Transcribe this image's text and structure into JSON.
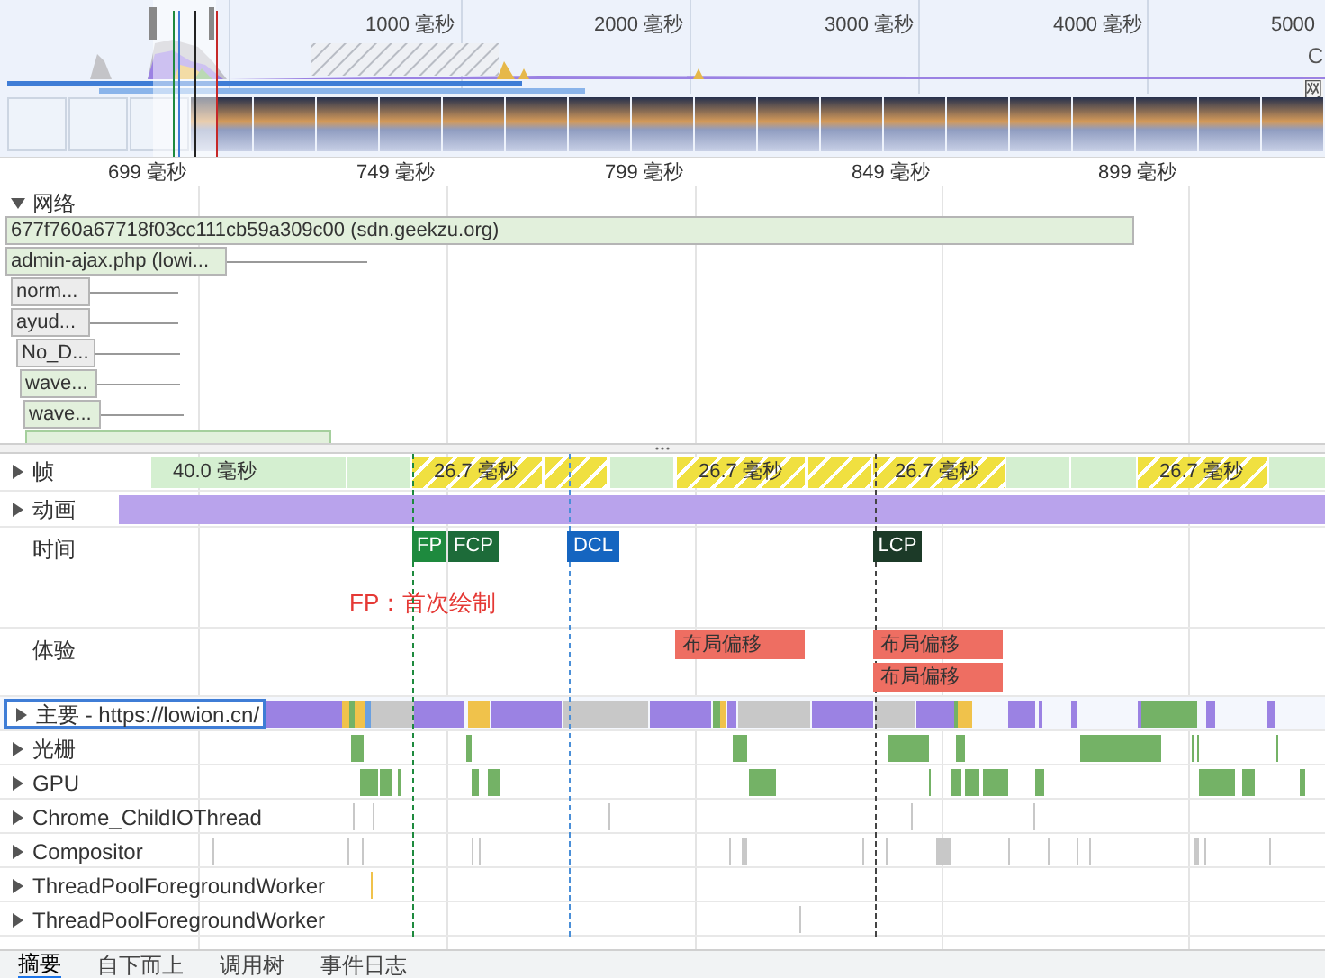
{
  "overview": {
    "ticks": [
      "1000 毫秒",
      "2000 毫秒",
      "3000 毫秒",
      "4000 毫秒",
      "5000"
    ],
    "edge_labels": [
      "C",
      "网"
    ]
  },
  "ruler": [
    "699 毫秒",
    "749 毫秒",
    "799 毫秒",
    "849 毫秒",
    "899 毫秒"
  ],
  "network": {
    "title": "网络",
    "expanded": true,
    "requests": [
      {
        "label": "677f760a67718f03cc111cb59a309c00 (sdn.geekzu.org)",
        "color": "#e2f0dc"
      },
      {
        "label": "admin-ajax.php (lowi...",
        "color": "#e2f0dc"
      },
      {
        "label": "norm...",
        "color": "#ececec"
      },
      {
        "label": "ayud...",
        "color": "#ececec"
      },
      {
        "label": "No_D...",
        "color": "#ececec"
      },
      {
        "label": "wave...",
        "color": "#e2f0dc"
      },
      {
        "label": "wave...",
        "color": "#e2f0dc"
      }
    ]
  },
  "frames": {
    "label": "帧",
    "expanded": false,
    "items": [
      {
        "label": "40.0 毫秒",
        "kind": "complete"
      },
      {
        "label": "26.7 毫秒",
        "kind": "partial"
      },
      {
        "label": "26.7 毫秒",
        "kind": "partial"
      },
      {
        "label": "26.7 毫秒",
        "kind": "partial"
      },
      {
        "label": "26.7 毫秒",
        "kind": "partial"
      }
    ]
  },
  "animation": {
    "label": "动画",
    "expanded": false
  },
  "timings": {
    "label": "时间",
    "annotation": "FP：首次绘制",
    "markers": [
      {
        "label": "FP",
        "color": "#1e8a3e"
      },
      {
        "label": "FCP",
        "color": "#1d6b39"
      },
      {
        "label": "DCL",
        "color": "#1565c0"
      },
      {
        "label": "LCP",
        "color": "#1c3a28"
      }
    ]
  },
  "experience": {
    "label": "体验",
    "events": [
      "布局偏移",
      "布局偏移",
      "布局偏移"
    ]
  },
  "threads": [
    {
      "label": "主要 - https://lowion.cn/",
      "expanded": false,
      "selected": true
    },
    {
      "label": "光栅",
      "expanded": false,
      "selected": false
    },
    {
      "label": "GPU",
      "expanded": false,
      "selected": false
    },
    {
      "label": "Chrome_ChildIOThread",
      "expanded": false,
      "selected": false
    },
    {
      "label": "Compositor",
      "expanded": false,
      "selected": false
    },
    {
      "label": "ThreadPoolForegroundWorker",
      "expanded": false,
      "selected": false
    },
    {
      "label": "ThreadPoolForegroundWorker",
      "expanded": false,
      "selected": false
    }
  ],
  "bottom_tabs": [
    {
      "label": "摘要",
      "selected": true
    },
    {
      "label": "自下而上",
      "selected": false
    },
    {
      "label": "调用树",
      "selected": false
    },
    {
      "label": "事件日志",
      "selected": false
    }
  ]
}
